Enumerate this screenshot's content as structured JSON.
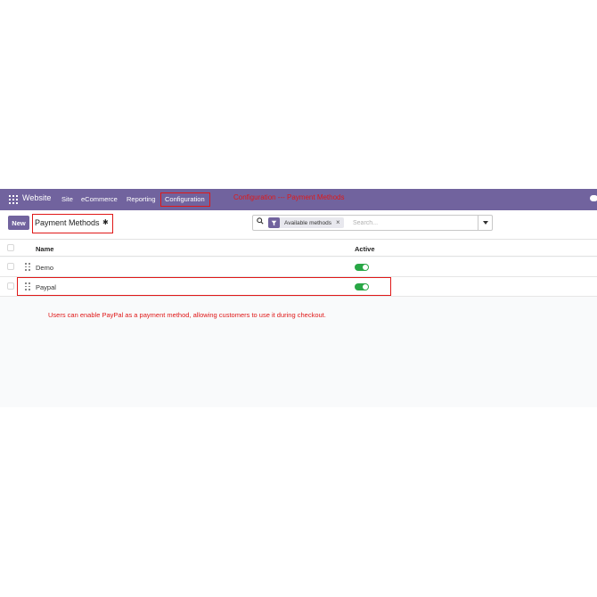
{
  "navbar": {
    "brand": "Website",
    "menus": [
      "Site",
      "eCommerce",
      "Reporting",
      "Configuration"
    ],
    "annotation": "Configuration --- Payment Methods"
  },
  "control": {
    "new_label": "New",
    "page_title": "Payment Methods",
    "search": {
      "facet_label": "Available methods",
      "facet_close": "×",
      "placeholder": "Search..."
    }
  },
  "list": {
    "columns": [
      "Name",
      "Active"
    ],
    "rows": [
      {
        "name": "Demo",
        "active": true
      },
      {
        "name": "Paypal",
        "active": true
      }
    ]
  },
  "note": "Users can enable PayPal as a payment method, allowing customers to use it during checkout.",
  "colors": {
    "brand": "#71639e",
    "annotation": "#e01818",
    "toggle_on": "#28a745"
  }
}
